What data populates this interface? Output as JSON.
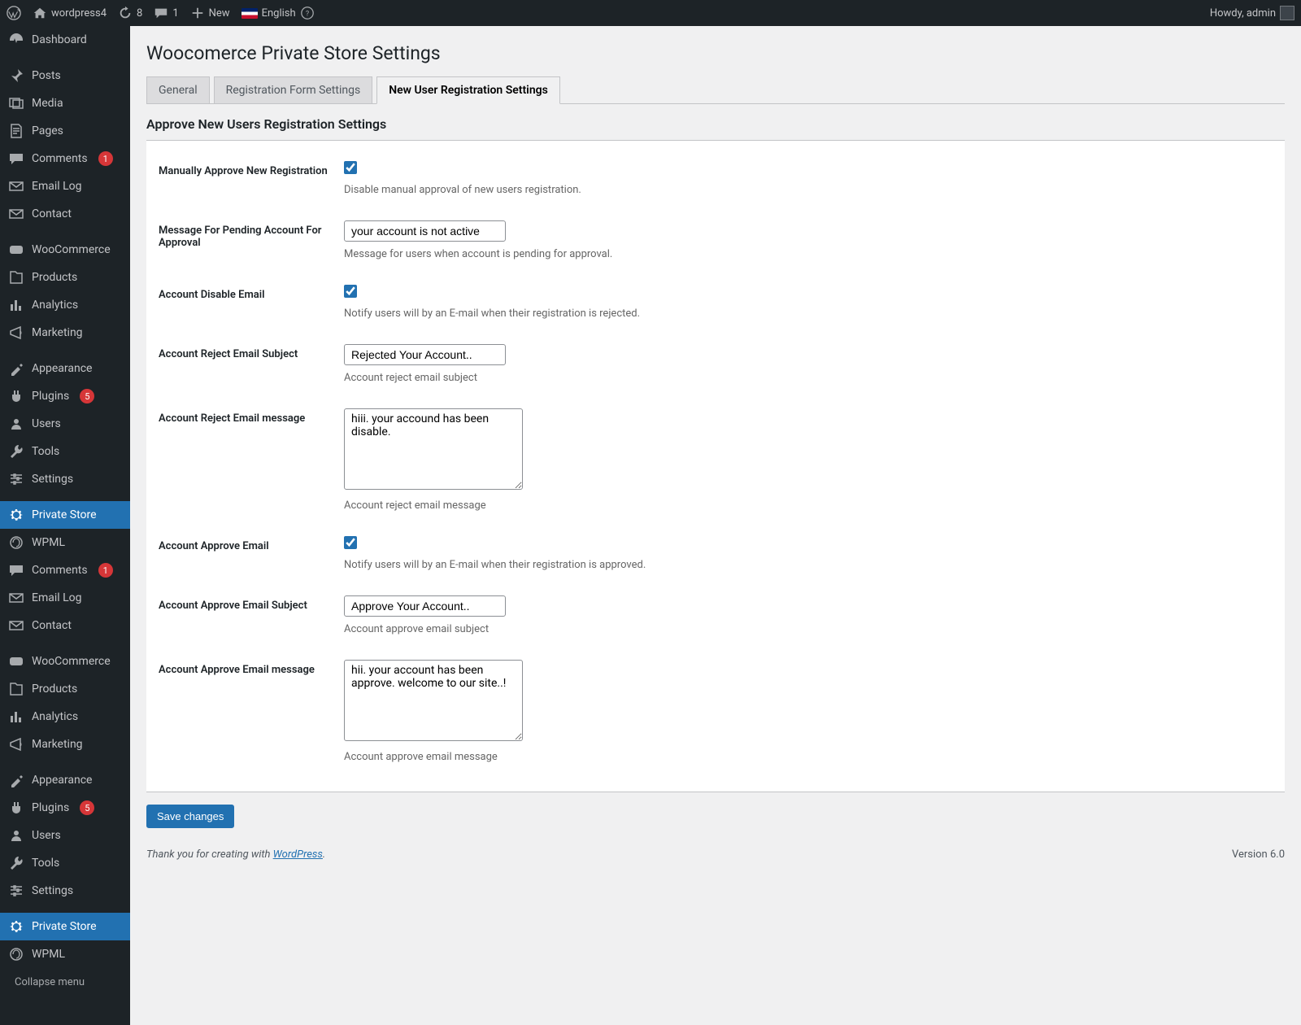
{
  "adminbar": {
    "site_name": "wordpress4",
    "updates_count": "8",
    "comments_count": "1",
    "new_label": "New",
    "language": "English",
    "howdy": "Howdy, admin"
  },
  "sidebar": {
    "items": [
      {
        "label": "Dashboard",
        "icon": "dashboard"
      },
      {
        "sep": true
      },
      {
        "label": "Posts",
        "icon": "pin"
      },
      {
        "label": "Media",
        "icon": "media"
      },
      {
        "label": "Pages",
        "icon": "pages"
      },
      {
        "label": "Comments",
        "icon": "comment",
        "badge": "1"
      },
      {
        "label": "Email Log",
        "icon": "mail"
      },
      {
        "label": "Contact",
        "icon": "mail"
      },
      {
        "sep": true
      },
      {
        "label": "WooCommerce",
        "icon": "woo"
      },
      {
        "label": "Products",
        "icon": "products"
      },
      {
        "label": "Analytics",
        "icon": "analytics"
      },
      {
        "label": "Marketing",
        "icon": "marketing"
      },
      {
        "sep": true
      },
      {
        "label": "Appearance",
        "icon": "appearance"
      },
      {
        "label": "Plugins",
        "icon": "plugins",
        "badge": "5"
      },
      {
        "label": "Users",
        "icon": "users"
      },
      {
        "label": "Tools",
        "icon": "tools"
      },
      {
        "label": "Settings",
        "icon": "settings"
      },
      {
        "sep": true
      },
      {
        "label": "Private Store",
        "icon": "gear",
        "active": true
      },
      {
        "label": "WPML",
        "icon": "wpml"
      },
      {
        "label": "Comments",
        "icon": "comment",
        "badge": "1"
      },
      {
        "label": "Email Log",
        "icon": "mail"
      },
      {
        "label": "Contact",
        "icon": "mail"
      },
      {
        "sep": true
      },
      {
        "label": "WooCommerce",
        "icon": "woo"
      },
      {
        "label": "Products",
        "icon": "products"
      },
      {
        "label": "Analytics",
        "icon": "analytics"
      },
      {
        "label": "Marketing",
        "icon": "marketing"
      },
      {
        "sep": true
      },
      {
        "label": "Appearance",
        "icon": "appearance"
      },
      {
        "label": "Plugins",
        "icon": "plugins",
        "badge": "5"
      },
      {
        "label": "Users",
        "icon": "users"
      },
      {
        "label": "Tools",
        "icon": "tools"
      },
      {
        "label": "Settings",
        "icon": "settings"
      },
      {
        "sep": true
      },
      {
        "label": "Private Store",
        "icon": "gear",
        "active": true
      },
      {
        "label": "WPML",
        "icon": "wpml"
      }
    ],
    "collapse_label": "Collapse menu"
  },
  "page": {
    "title": "Woocomerce Private Store Settings",
    "tabs": [
      {
        "label": "General"
      },
      {
        "label": "Registration Form Settings"
      },
      {
        "label": "New User Registration Settings",
        "active": true
      }
    ],
    "section_title": "Approve New Users Registration Settings",
    "fields": {
      "manual_approve": {
        "label": "Manually Approve New Registration",
        "desc": "Disable manual approval of new users registration.",
        "checked": true
      },
      "pending_msg": {
        "label": "Message For Pending Account For Approval",
        "value": "your account is not active",
        "desc": "Message for users when account is pending for approval."
      },
      "disable_email": {
        "label": "Account Disable Email",
        "desc": "Notify users will by an E-mail when their registration is rejected.",
        "checked": true
      },
      "reject_subject": {
        "label": "Account Reject Email Subject",
        "value": "Rejected Your Account..",
        "desc": "Account reject email subject"
      },
      "reject_msg": {
        "label": "Account Reject Email message",
        "value": "hiii. your accound has been disable.",
        "desc": "Account reject email message"
      },
      "approve_email": {
        "label": "Account Approve Email",
        "desc": "Notify users will by an E-mail when their registration is approved.",
        "checked": true
      },
      "approve_subject": {
        "label": "Account Approve Email Subject",
        "value": "Approve Your Account..",
        "desc": "Account approve email subject"
      },
      "approve_msg": {
        "label": "Account Approve Email message",
        "value": "hii. your account has been approve. welcome to our site..!",
        "desc": "Account approve email message"
      }
    },
    "save_label": "Save changes"
  },
  "footer": {
    "thanks_prefix": "Thank you for creating with ",
    "wp_link": "WordPress",
    "version": "Version 6.0"
  }
}
